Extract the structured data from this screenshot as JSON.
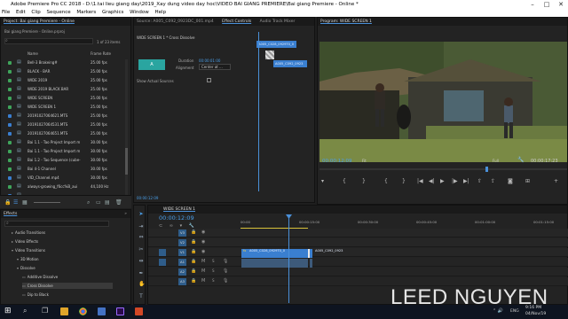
{
  "window": {
    "title": "Adobe Premiere Pro CC 2018 - D:\\1.tai lieu giang day\\2019_Xay dung video day hoc\\VIDEO BAI GIANG PREMIERE\\Bai giang Premiere - Online *",
    "minimize": "–",
    "maximize": "□",
    "close": "✕"
  },
  "menu": [
    "File",
    "Edit",
    "Clip",
    "Sequence",
    "Markers",
    "Graphics",
    "Window",
    "Help"
  ],
  "project": {
    "tab": "Project: Bai giang Premiere - Online",
    "file": "Bai giang Premiere - Online.prproj",
    "count": "1 of 23 items",
    "col_name": "Name",
    "col_fr": "Frame Rate",
    "rows": [
      {
        "name": "Bell-3 Brakeing#",
        "fr": "25.00 fps",
        "color": "#3fa55b"
      },
      {
        "name": "BLACK - BAR",
        "fr": "25.00 fps",
        "color": "#3fa55b"
      },
      {
        "name": "WIDE 2019",
        "fr": "25.00 fps",
        "color": "#3fa55b"
      },
      {
        "name": "WIDE 2019 BLACK BAR",
        "fr": "25.00 fps",
        "color": "#3fa55b"
      },
      {
        "name": "WIDE SCREEN",
        "fr": "25.00 fps",
        "color": "#3fa55b"
      },
      {
        "name": "WIDE SCREEN 1",
        "fr": "25.00 fps",
        "color": "#3fa55b"
      },
      {
        "name": "20191027064621.MTS",
        "fr": "25.00 fps",
        "color": "#3a7fd0"
      },
      {
        "name": "20191027064531.MTS",
        "fr": "25.00 fps",
        "color": "#3a7fd0"
      },
      {
        "name": "20191027064651.MTS",
        "fr": "25.00 fps",
        "color": "#3a7fd0"
      },
      {
        "name": "Bai 1.1 - Tao Project Import m",
        "fr": "30.00 fps",
        "color": "#3fa55b"
      },
      {
        "name": "Bai 1.1 - Tao Project Import m",
        "fr": "30.00 fps",
        "color": "#3fa55b"
      },
      {
        "name": "Bai 1.2 - Tao Sequence (cube-",
        "fr": "30.00 fps",
        "color": "#3fa55b"
      },
      {
        "name": "Bai 4-1 Channel",
        "fr": "30.00 fps",
        "color": "#3fa55b"
      },
      {
        "name": "VID_Channel.mp4",
        "fr": "30.00 fps",
        "color": "#3a7fd0"
      },
      {
        "name": "always-growing_f6cc%B_aui",
        "fr": "44,100 Hz",
        "color": "#3fa55b"
      },
      {
        "name": "...",
        "fr": "",
        "color": "#3a7fd0"
      }
    ]
  },
  "effects": {
    "tab": "Effects",
    "items": [
      {
        "label": "Audio Transitions",
        "indent": 1
      },
      {
        "label": "Video Effects",
        "indent": 1
      },
      {
        "label": "Video Transitions",
        "indent": 1
      },
      {
        "label": "3D Motion",
        "indent": 2
      },
      {
        "label": "Dissolve",
        "indent": 2
      },
      {
        "label": "Additive Dissolve",
        "indent": 3
      },
      {
        "label": "Cross Dissolve",
        "indent": 3
      },
      {
        "label": "Dip to Black",
        "indent": 3
      }
    ]
  },
  "effect_controls": {
    "tabs": [
      "Source: A005_C092_0923DC_001.mp4",
      "Effect Controls",
      "Audio Track Mixer"
    ],
    "header": "WIDE SCREEN 1 * Cross Dissolve",
    "duration_label": "Duration",
    "duration_value": "00:00:01:00",
    "alignment_label": "Alignment",
    "alignment_value": "Center at ...",
    "show_actual_sources": "Show Actual Sources",
    "clip_a": "A005_C028_0929T0_0",
    "clip_b": "A005_C092_0923",
    "timecode": "00:00:12:09",
    "preview_label": "A"
  },
  "program": {
    "tab": "Program: WIDE SCREEN 1",
    "timecode": "00:00:12:09",
    "fit": "Fit",
    "quality": "Full",
    "duration": "00:00:17:23"
  },
  "timeline": {
    "tab": "WIDE SCREEN 1",
    "timecode": "00:00:12:09",
    "ruler": [
      "00:00",
      "00:00:15:00",
      "00:00:30:00",
      "00:00:45:00",
      "00:01:00:00",
      "00:01:15:00"
    ],
    "tracks": [
      "V3",
      "V2",
      "V1",
      "A1",
      "A2",
      "A3"
    ],
    "clip_1": "A005_C028_0929T0_0",
    "clip_2": "A005_C092_0923"
  },
  "watermark": "LEED NGUYEN",
  "taskbar": {
    "time": "9:16 PM",
    "date": "04/Nov/19",
    "lang": "ENG"
  }
}
